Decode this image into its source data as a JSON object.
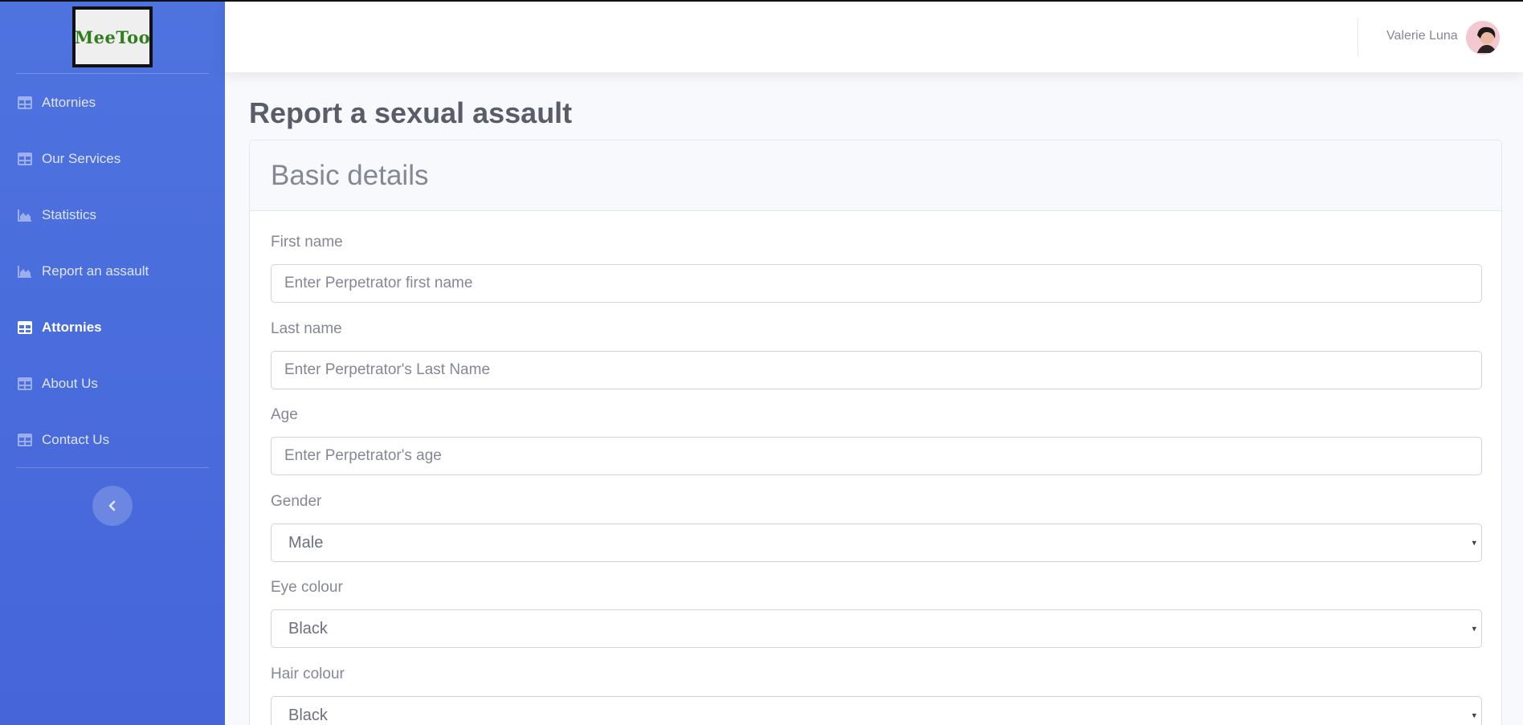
{
  "brand": {
    "logo_text": "MeeToo"
  },
  "sidebar": {
    "items": [
      {
        "label": "Attornies",
        "icon": "table-icon",
        "active": false
      },
      {
        "label": "Our Services",
        "icon": "table-icon",
        "active": false
      },
      {
        "label": "Statistics",
        "icon": "area-chart-icon",
        "active": false
      },
      {
        "label": "Report an assault",
        "icon": "area-chart-icon",
        "active": false
      },
      {
        "label": "Attornies",
        "icon": "table-icon",
        "active": true
      },
      {
        "label": "About Us",
        "icon": "table-icon",
        "active": false
      },
      {
        "label": "Contact Us",
        "icon": "table-icon",
        "active": false
      }
    ],
    "toggle_icon": "chevron-left-icon"
  },
  "topbar": {
    "user_name": "Valerie Luna"
  },
  "page": {
    "title": "Report a sexual assault"
  },
  "form": {
    "section_title": "Basic details",
    "first_name": {
      "label": "First name",
      "placeholder": "Enter Perpetrator first name"
    },
    "last_name": {
      "label": "Last name",
      "placeholder": "Enter Perpetrator's Last Name"
    },
    "age": {
      "label": "Age",
      "placeholder": "Enter Perpetrator's age"
    },
    "gender": {
      "label": "Gender",
      "value": "Male"
    },
    "eye_colour": {
      "label": "Eye colour",
      "value": "Black"
    },
    "hair_colour": {
      "label": "Hair colour",
      "value": "Black"
    }
  },
  "colors": {
    "sidebar_bg": "#4e73df",
    "page_bg": "#f8f9fc",
    "text_muted": "#858796",
    "title_text": "#5a5c69",
    "logo_text": "#2f7d1e"
  }
}
